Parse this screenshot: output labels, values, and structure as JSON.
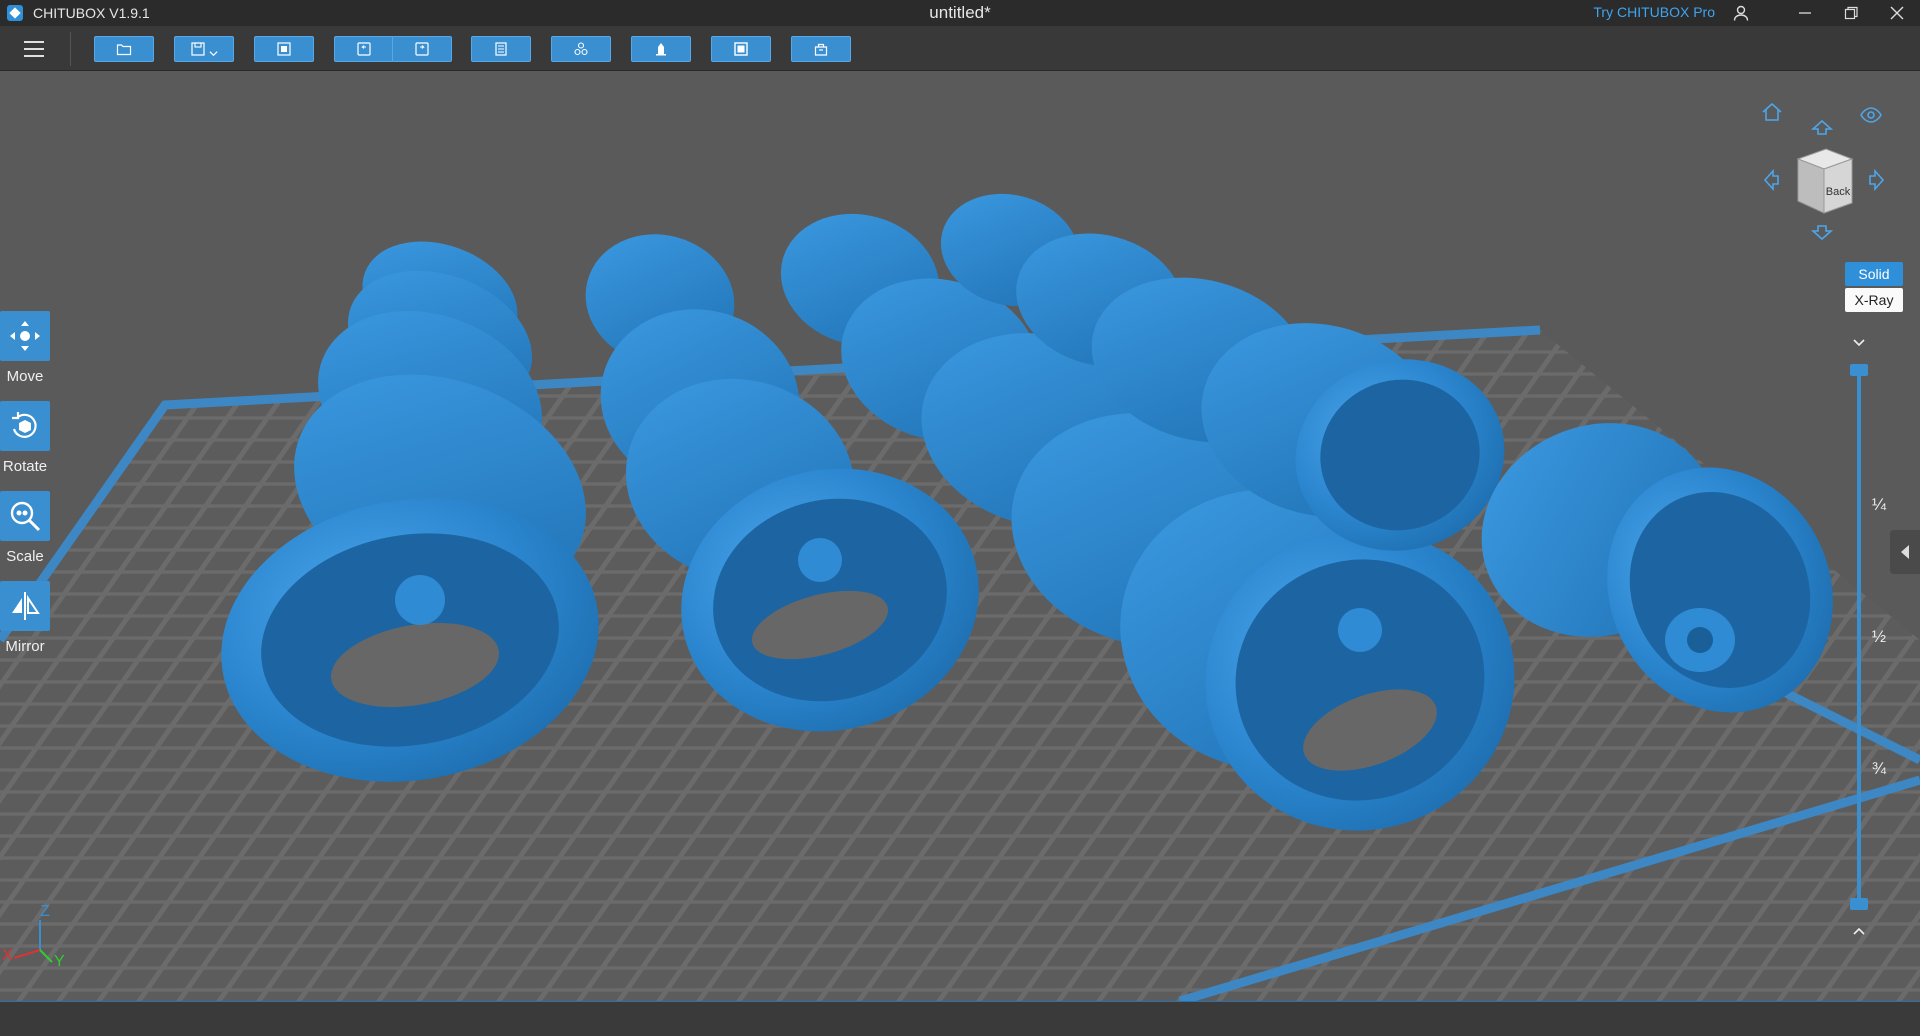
{
  "app": {
    "name": "CHITUBOX V1.9.1",
    "document_title": "untitled*",
    "try_pro": "Try CHITUBOX Pro"
  },
  "toolbar": {
    "buttons": [
      "open-icon",
      "save-icon",
      "fit-icon",
      "undo-icon",
      "redo-icon",
      "layout-icon",
      "arrange-icon",
      "support-icon",
      "hollow-icon",
      "slice-icon"
    ]
  },
  "tools": {
    "move": "Move",
    "rotate": "Rotate",
    "scale": "Scale",
    "mirror": "Mirror"
  },
  "view": {
    "cube_face": "Back",
    "solid": "Solid",
    "xray": "X-Ray",
    "mode_selected": "Solid"
  },
  "layer_slider": {
    "q1": "¼",
    "q2": "½",
    "q3": "¾",
    "top_value": 1.0,
    "bottom_value": 0.0
  },
  "axes": {
    "x": "X",
    "y": "Y",
    "z": "Z"
  },
  "colors": {
    "model": "#2e8bd6",
    "accent": "#3a8fd0",
    "plate": "#6a6a6a"
  }
}
